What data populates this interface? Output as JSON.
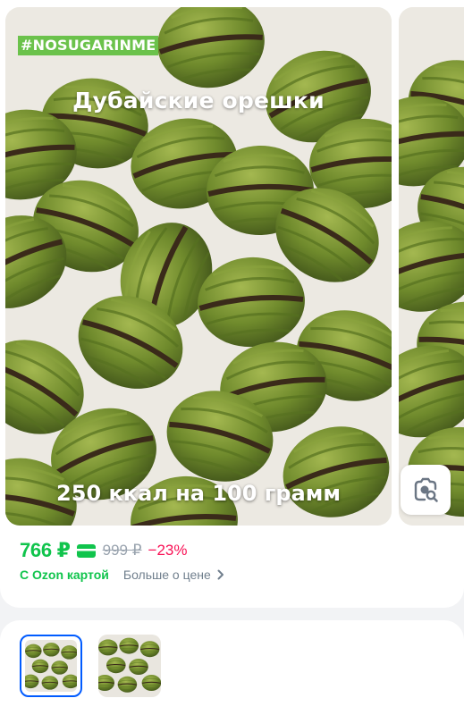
{
  "gallery": {
    "hashtag": "#NOSUGARINME",
    "headline": "Дубайские орешки",
    "calories": "250 ккал на 100 грамм",
    "search_icon": "camera-search-icon"
  },
  "pricing": {
    "price": "766 ₽",
    "card_icon": "ozon-card-icon",
    "old_price": "999 ₽",
    "discount": "−23%",
    "ozon_card_label": "С Ozon картой",
    "more_price_label": "Больше о цене"
  },
  "thumbnails": [
    {
      "selected": true
    },
    {
      "selected": false
    }
  ],
  "colors": {
    "price_green": "#10c44c",
    "discount_pink": "#f91155",
    "selection_blue": "#005bff",
    "hashtag_bg": "#6bc24b"
  }
}
